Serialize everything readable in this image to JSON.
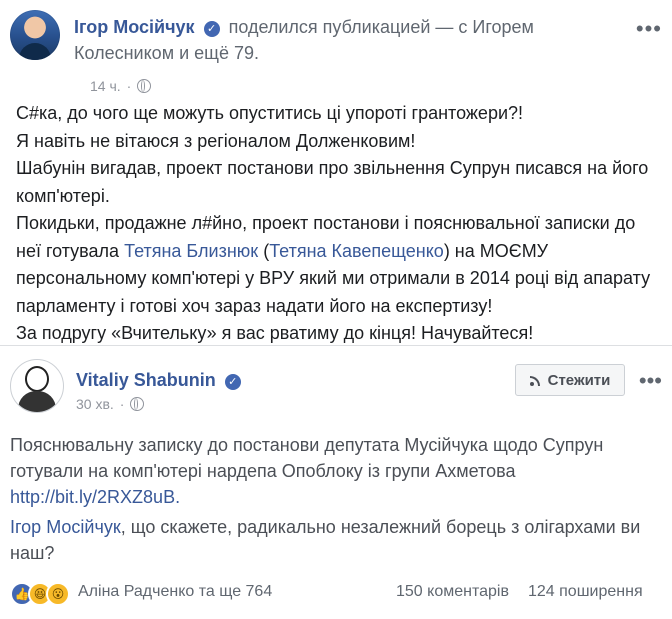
{
  "post": {
    "author": "Ігор Мосійчук",
    "action": "поделился публикацией — с Игорем Колесником и ещё 79.",
    "time": "14 ч.",
    "text_lines": [
      "С#ка, до чого ще можуть опуститись ці упороті грантожери?!",
      "Я навіть не вітаюся з регіоналом Долженковим!",
      "Шабунін вигадав, проект постанови про звільнення Супрун писався на його комп'ютері.",
      "Покидьки, продажне л#йно, проект постанови і пояснювальної записки до неї готувала",
      "Тетяна Близнюк",
      "(",
      "Тетяна Кавепещенко",
      ") на МОЄМУ персональному комп'ютері у ВРУ який ми отримали в 2014 році від апарату парламенту і готові хоч зараз надати його на експертизу!",
      "За подругу «Вчительку» я вас рватиму до кінця! Начувайтеся!"
    ]
  },
  "shared": {
    "author": "Vitaliy Shabunin",
    "time": "30 хв.",
    "follow_label": "Стежити",
    "text_main": "Пояснювальну записку до постанови депутата Мусійчука щодо Супрун готували на комп'ютері нардепа Опоблоку із групи Ахметова",
    "link": "http://bit.ly/2RXZ8uB.",
    "mention": "Ігор Мосійчук",
    "text_tail": ", що скажете, радикально незалежний борець з олігархами ви наш?"
  },
  "footer": {
    "reactions_text": "Аліна Радченко та ще 764",
    "comments": "150 коментарів",
    "shares": "124 поширення"
  },
  "icons": {
    "like": "like-icon",
    "haha": "haha-icon",
    "wow": "wow-icon",
    "verified": "verified-icon",
    "globe": "globe-icon",
    "rss": "rss-icon",
    "more": "more-icon"
  },
  "colors": {
    "link": "#385898",
    "accent": "#4267b2",
    "meta": "#90949c"
  }
}
